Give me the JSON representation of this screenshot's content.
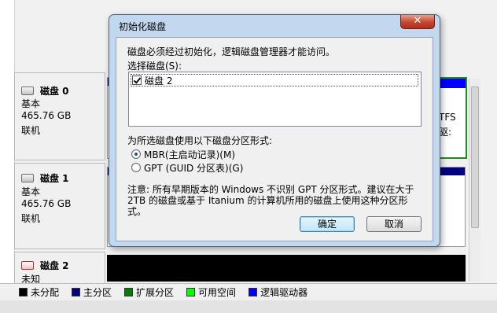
{
  "disks": [
    {
      "name": "磁盘 0",
      "type": "基本",
      "size": "465.76 GB",
      "status": "联机"
    },
    {
      "name": "磁盘 1",
      "type": "基本",
      "size": "465.76 GB",
      "status": "联机"
    },
    {
      "name": "磁盘 2",
      "type": "未知",
      "size": "",
      "status": ""
    }
  ],
  "volume_fragments": {
    "fs": "TFS",
    "label": "驱:"
  },
  "legend": [
    {
      "label": "未分配",
      "color": "#000000"
    },
    {
      "label": "主分区",
      "color": "#000080"
    },
    {
      "label": "扩展分区",
      "color": "#008000"
    },
    {
      "label": "可用空间",
      "color": "#00ff00"
    },
    {
      "label": "逻辑驱动器",
      "color": "#0000ff"
    }
  ],
  "dialog": {
    "title": "初始化磁盘",
    "close_glyph": "✕",
    "intro": "磁盘必须经过初始化，逻辑磁盘管理器才能访问。",
    "select_label": "选择磁盘(S):",
    "disk_list": [
      {
        "label": "磁盘 2",
        "checked": true
      }
    ],
    "partition_label": "为所选磁盘使用以下磁盘分区形式:",
    "options": [
      {
        "label": "MBR(主启动记录)(M)",
        "selected": true
      },
      {
        "label": "GPT (GUID 分区表)(G)",
        "selected": false
      }
    ],
    "note_line1": "注意: 所有早期版本的 Windows 不识别 GPT 分区形式。建议在大于",
    "note_line2": "2TB 的磁盘或基于 Itanium 的计算机所用的磁盘上使用这种分区形",
    "note_line3": "式。",
    "ok": "确定",
    "cancel": "取消"
  }
}
